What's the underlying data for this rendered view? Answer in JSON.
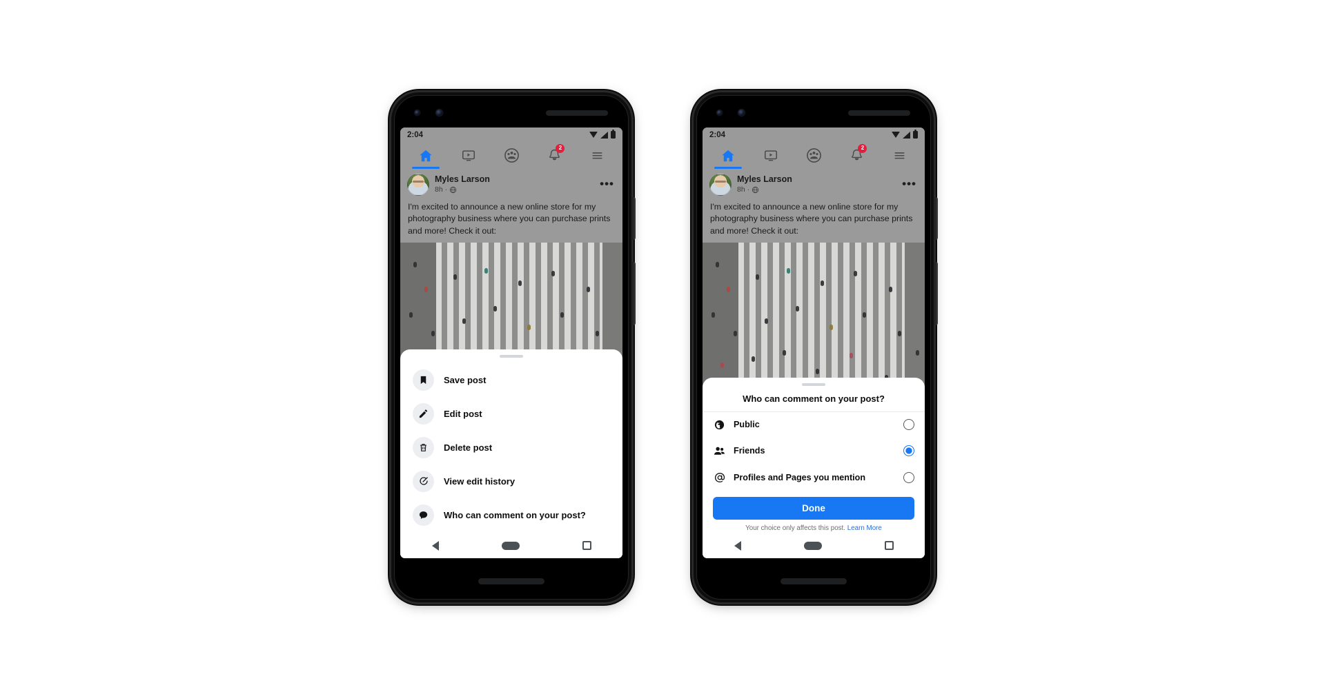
{
  "phones": [
    {
      "id": "left",
      "status_bar": {
        "time": "2:04",
        "icons": [
          "wifi-icon",
          "signal-icon",
          "battery-icon"
        ]
      },
      "nav_tabs": [
        {
          "name": "home",
          "icon": "home-icon",
          "active": true,
          "badge": ""
        },
        {
          "name": "video",
          "icon": "video-icon",
          "active": false,
          "badge": ""
        },
        {
          "name": "groups",
          "icon": "groups-icon",
          "active": false,
          "badge": ""
        },
        {
          "name": "notifications",
          "icon": "bell-icon",
          "active": false,
          "badge": "2"
        },
        {
          "name": "menu",
          "icon": "hamburger-icon",
          "active": false,
          "badge": ""
        }
      ],
      "post": {
        "author": "Myles Larson",
        "time": "8h",
        "separator": "·",
        "audience_icon": "globe-icon",
        "more_icon": "•••",
        "text": "I'm excited to announce a new online store for my photography business where you can purchase prints and more! Check it out:",
        "photo_alt": "aerial-crosswalk-photo"
      },
      "sheet": {
        "type": "menu",
        "items": [
          {
            "icon": "bookmark-icon",
            "label": "Save post"
          },
          {
            "icon": "pencil-icon",
            "label": "Edit post"
          },
          {
            "icon": "trash-icon",
            "label": "Delete post"
          },
          {
            "icon": "history-icon",
            "label": "View edit history"
          },
          {
            "icon": "comment-icon",
            "label": "Who can comment on your post?"
          }
        ]
      },
      "android_nav": [
        "back-icon",
        "home-pill-icon",
        "recents-icon"
      ]
    },
    {
      "id": "right",
      "status_bar": {
        "time": "2:04",
        "icons": [
          "wifi-icon",
          "signal-icon",
          "battery-icon"
        ]
      },
      "nav_tabs": [
        {
          "name": "home",
          "icon": "home-icon",
          "active": true,
          "badge": ""
        },
        {
          "name": "video",
          "icon": "video-icon",
          "active": false,
          "badge": ""
        },
        {
          "name": "groups",
          "icon": "groups-icon",
          "active": false,
          "badge": ""
        },
        {
          "name": "notifications",
          "icon": "bell-icon",
          "active": false,
          "badge": "2"
        },
        {
          "name": "menu",
          "icon": "hamburger-icon",
          "active": false,
          "badge": ""
        }
      ],
      "post": {
        "author": "Myles Larson",
        "time": "8h",
        "separator": "·",
        "audience_icon": "globe-icon",
        "more_icon": "•••",
        "text": "I'm excited to announce a new online store for my photography business where you can purchase prints and more! Check it out:",
        "photo_alt": "aerial-crosswalk-photo"
      },
      "sheet": {
        "type": "dialog",
        "title": "Who can comment on your post?",
        "options": [
          {
            "icon": "globe-icon",
            "label": "Public",
            "selected": false
          },
          {
            "icon": "friends-icon",
            "label": "Friends",
            "selected": true
          },
          {
            "icon": "at-icon",
            "label": "Profiles and Pages you mention",
            "selected": false
          }
        ],
        "done_label": "Done",
        "footer_text": "Your choice only affects this post.",
        "footer_link": "Learn More"
      },
      "android_nav": [
        "back-icon",
        "home-pill-icon",
        "recents-icon"
      ]
    }
  ],
  "colors": {
    "accent_blue": "#1877f2",
    "badge_red": "#e41e3f",
    "link_blue": "#2d6ed4",
    "sheet_white": "#ffffff",
    "screen_gray": "#9a9a9a",
    "page_bg": "#ffffff"
  }
}
